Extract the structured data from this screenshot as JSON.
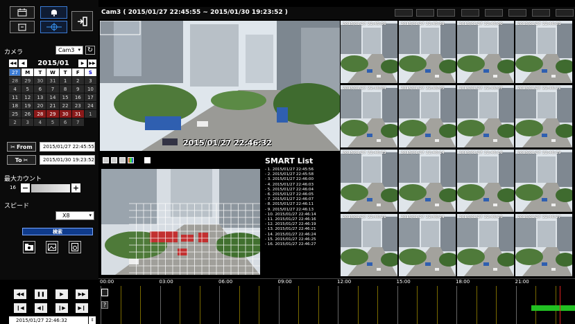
{
  "toolbar": {
    "calendar_icon": "calendar-icon",
    "alarm_icon": "bell-icon",
    "exit_icon": "exit-icon",
    "archive_icon": "archive-icon",
    "ptz_icon": "ptz-icon"
  },
  "left": {
    "camera_label": "カメラ",
    "camera_value": "Cam3",
    "calendar": {
      "month": "2015/01",
      "dow": [
        "S",
        "M",
        "T",
        "W",
        "T",
        "F",
        "S"
      ],
      "weeks": [
        [
          "28",
          "29",
          "30",
          "31",
          "1",
          "2",
          "3"
        ],
        [
          "4",
          "5",
          "6",
          "7",
          "8",
          "9",
          "10"
        ],
        [
          "11",
          "12",
          "13",
          "14",
          "15",
          "16",
          "17"
        ],
        [
          "18",
          "19",
          "20",
          "21",
          "22",
          "23",
          "24"
        ],
        [
          "25",
          "26",
          "27",
          "28",
          "29",
          "30",
          "31"
        ],
        [
          "1",
          "2",
          "3",
          "4",
          "5",
          "6",
          "7"
        ]
      ]
    },
    "from_label": "From",
    "from_value": "2015/01/27 22:45:55",
    "to_label": "To",
    "to_value": "2015/01/30 19:23:52",
    "max_count_label": "最大カウント",
    "max_count_value": "16",
    "speed_label": "スピード",
    "speed_value": "X8",
    "search_label": "検索",
    "playback_time": "2015/01/27 22:46:32"
  },
  "header": {
    "title": "Cam3 ( 2015/01/27 22:45:55 ~ 2015/01/30 19:23:52 )",
    "buttons": [
      "",
      "",
      "",
      "",
      "",
      "",
      "",
      ""
    ]
  },
  "main": {
    "video_timestamp": "2015/01/27 22:46:32"
  },
  "smart": {
    "title": "SMART List",
    "items": [
      "- 1. 2015/01/27 22:45:56",
      "- 2. 2015/01/27 22:45:58",
      "- 3. 2015/01/27 22:46:00",
      "- 4. 2015/01/27 22:46:03",
      "- 5. 2015/01/27 22:46:04",
      "- 6. 2015/01/27 22:46:05",
      "- 7. 2015/01/27 22:46:07",
      "- 8. 2015/01/27 22:46:11",
      "- 9. 2015/01/27 22:46:13",
      "- 10. 2015/01/27 22:46:14",
      "- 11. 2015/01/27 22:46:16",
      "- 12. 2015/01/27 22:46:19",
      "- 13. 2015/01/27 22:46:21",
      "- 14. 2015/01/27 22:46:24",
      "- 15. 2015/01/27 22:46:25",
      "- 16. 2015/01/27 22:46:27"
    ]
  },
  "thumbnails": [
    "2015/01/27 22:45:56",
    "2015/01/27 22:45:58",
    "2015/01/27 22:46:00",
    "2015/01/27 22:46:03",
    "2015/01/27 22:46:04",
    "2015/01/27 22:46:05",
    "2015/01/27 22:46:07",
    "2015/01/27 22:46:11",
    "2015/01/27 22:46:13",
    "2015/01/27 22:46:14",
    "2015/01/27 22:46:16",
    "2015/01/27 22:46:19",
    "2015/01/27 22:46:21",
    "2015/01/27 22:46:24",
    "2015/01/27 22:46:25",
    "2015/01/27 22:46:27"
  ],
  "timeline": {
    "ticks": [
      "00:00",
      "03:00",
      "06:00",
      "09:00",
      "12:00",
      "15:00",
      "18:00",
      "21:00"
    ],
    "help_label": "?"
  },
  "colors": {
    "accent": "#3a7bd5",
    "recording": "#22c022",
    "cursor": "#e02020"
  }
}
